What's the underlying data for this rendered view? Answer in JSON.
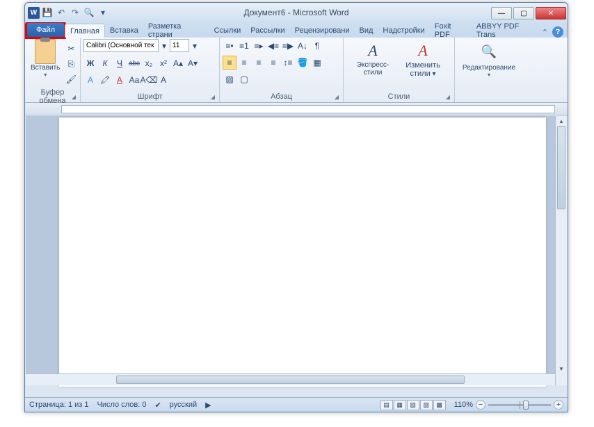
{
  "title": "Документ6 - Microsoft Word",
  "qat": {
    "save": "💾",
    "undo": "↶",
    "redo": "↷",
    "find": "🔍"
  },
  "tabs": {
    "file": "Файл",
    "items": [
      "Главная",
      "Вставка",
      "Разметка страни",
      "Ссылки",
      "Рассылки",
      "Рецензировани",
      "Вид",
      "Надстройки",
      "Foxit PDF",
      "ABBYY PDF Trans"
    ]
  },
  "ribbon": {
    "clipboard": {
      "paste": "Вставить",
      "label": "Буфер обмена"
    },
    "font": {
      "name": "Calibri (Основной тек",
      "size": "11",
      "label": "Шрифт",
      "bold": "Ж",
      "italic": "К",
      "underline": "Ч",
      "strike": "abc",
      "sub": "x₂",
      "sup": "x²"
    },
    "paragraph": {
      "label": "Абзац"
    },
    "styles": {
      "label": "Стили",
      "quick": "Экспресс-стили",
      "change": "Изменить стили"
    },
    "editing": {
      "label": "Редактирование",
      "find": "🔍"
    }
  },
  "status": {
    "page": "Страница: 1 из 1",
    "words": "Число слов: 0",
    "lang": "русский",
    "zoom": "110%"
  }
}
